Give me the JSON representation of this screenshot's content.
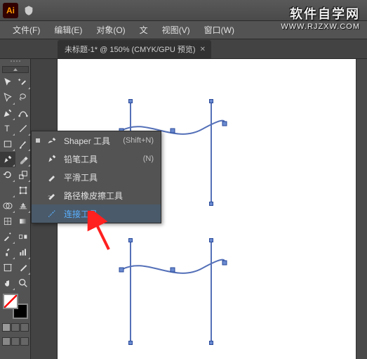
{
  "app": {
    "name": "Ai"
  },
  "menubar": {
    "items": [
      {
        "label": "文件(F)"
      },
      {
        "label": "编辑(E)"
      },
      {
        "label": "对象(O)"
      },
      {
        "label": "文"
      },
      {
        "label": ""
      },
      {
        "label": ""
      },
      {
        "label": "视图(V)"
      },
      {
        "label": "窗口(W)"
      }
    ]
  },
  "tab": {
    "title": "未标题-1* @ 150% (CMYK/GPU 预览)"
  },
  "flyout": {
    "items": [
      {
        "label": "Shaper 工具",
        "shortcut": "(Shift+N)",
        "dot": true
      },
      {
        "label": "铅笔工具",
        "shortcut": "(N)",
        "dot": false
      },
      {
        "label": "平滑工具",
        "shortcut": "",
        "dot": false
      },
      {
        "label": "路径橡皮擦工具",
        "shortcut": "",
        "dot": false
      },
      {
        "label": "连接工具",
        "shortcut": "",
        "dot": false
      }
    ]
  },
  "watermark": {
    "cn": "软件自学网",
    "en": "WWW.RJZXW.COM"
  }
}
